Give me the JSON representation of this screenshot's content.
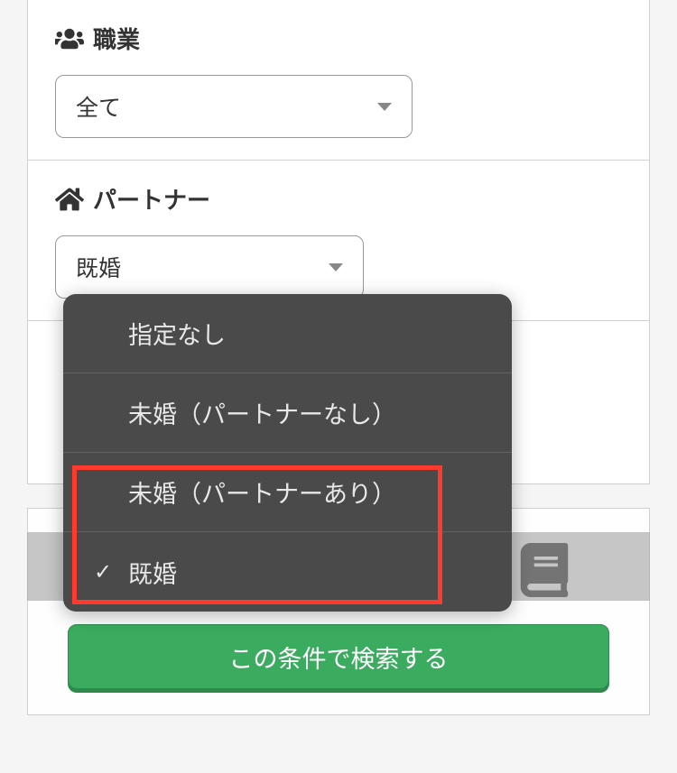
{
  "sections": {
    "occupation": {
      "label": "職業",
      "selected_value": "全て"
    },
    "partner": {
      "label": "パートナー",
      "selected_value": "既婚"
    }
  },
  "dropdown": {
    "items": [
      {
        "label": "指定なし",
        "selected": false
      },
      {
        "label": "未婚（パートナーなし）",
        "selected": false
      },
      {
        "label": "未婚（パートナーあり）",
        "selected": false
      },
      {
        "label": "既婚",
        "selected": true
      }
    ]
  },
  "search_button": {
    "label": "この条件で検索する"
  }
}
